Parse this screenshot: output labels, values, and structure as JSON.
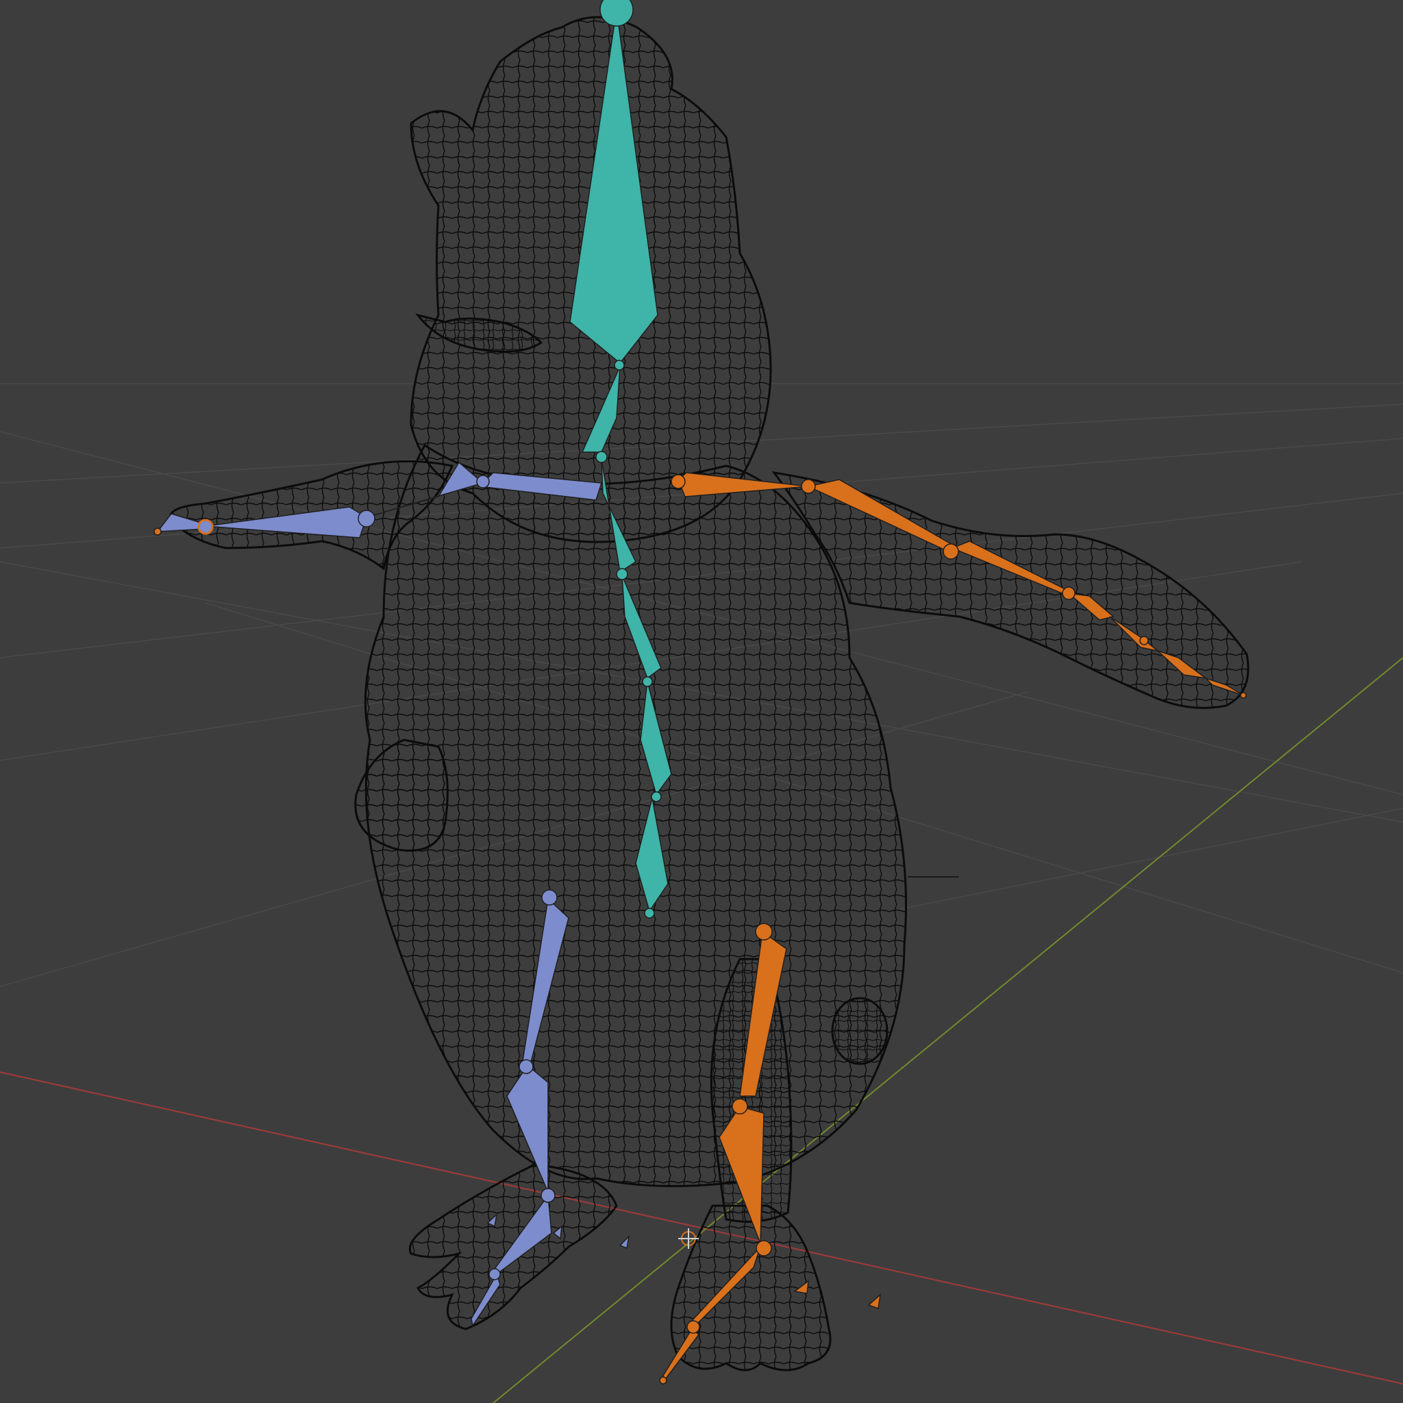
{
  "app": "3D viewport",
  "viewport": {
    "background": "#3d3d3d",
    "grid_color": "#4a4a4a",
    "axis_x_color": "#a23a3a",
    "axis_y_color": "#718a2c",
    "wireframe_color": "#0b0b0b"
  },
  "armature": {
    "center_bones_color": "#3fb4a8",
    "left_bones_color": "#7d8ccc",
    "right_bones_color": "#d9701c",
    "bone_outline_color": "#1f1f1f"
  },
  "icons": {
    "origin": "3d-cursor-icon"
  }
}
